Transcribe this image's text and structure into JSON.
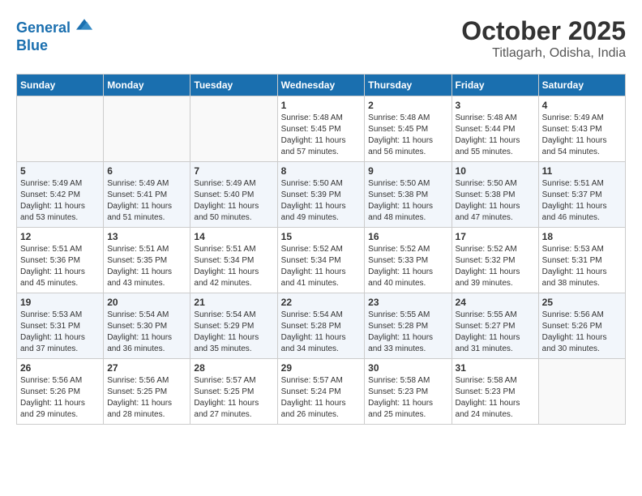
{
  "header": {
    "logo_line1": "General",
    "logo_line2": "Blue",
    "month": "October 2025",
    "location": "Titlagarh, Odisha, India"
  },
  "weekdays": [
    "Sunday",
    "Monday",
    "Tuesday",
    "Wednesday",
    "Thursday",
    "Friday",
    "Saturday"
  ],
  "weeks": [
    [
      {
        "num": "",
        "info": ""
      },
      {
        "num": "",
        "info": ""
      },
      {
        "num": "",
        "info": ""
      },
      {
        "num": "1",
        "info": "Sunrise: 5:48 AM\nSunset: 5:45 PM\nDaylight: 11 hours\nand 57 minutes."
      },
      {
        "num": "2",
        "info": "Sunrise: 5:48 AM\nSunset: 5:45 PM\nDaylight: 11 hours\nand 56 minutes."
      },
      {
        "num": "3",
        "info": "Sunrise: 5:48 AM\nSunset: 5:44 PM\nDaylight: 11 hours\nand 55 minutes."
      },
      {
        "num": "4",
        "info": "Sunrise: 5:49 AM\nSunset: 5:43 PM\nDaylight: 11 hours\nand 54 minutes."
      }
    ],
    [
      {
        "num": "5",
        "info": "Sunrise: 5:49 AM\nSunset: 5:42 PM\nDaylight: 11 hours\nand 53 minutes."
      },
      {
        "num": "6",
        "info": "Sunrise: 5:49 AM\nSunset: 5:41 PM\nDaylight: 11 hours\nand 51 minutes."
      },
      {
        "num": "7",
        "info": "Sunrise: 5:49 AM\nSunset: 5:40 PM\nDaylight: 11 hours\nand 50 minutes."
      },
      {
        "num": "8",
        "info": "Sunrise: 5:50 AM\nSunset: 5:39 PM\nDaylight: 11 hours\nand 49 minutes."
      },
      {
        "num": "9",
        "info": "Sunrise: 5:50 AM\nSunset: 5:38 PM\nDaylight: 11 hours\nand 48 minutes."
      },
      {
        "num": "10",
        "info": "Sunrise: 5:50 AM\nSunset: 5:38 PM\nDaylight: 11 hours\nand 47 minutes."
      },
      {
        "num": "11",
        "info": "Sunrise: 5:51 AM\nSunset: 5:37 PM\nDaylight: 11 hours\nand 46 minutes."
      }
    ],
    [
      {
        "num": "12",
        "info": "Sunrise: 5:51 AM\nSunset: 5:36 PM\nDaylight: 11 hours\nand 45 minutes."
      },
      {
        "num": "13",
        "info": "Sunrise: 5:51 AM\nSunset: 5:35 PM\nDaylight: 11 hours\nand 43 minutes."
      },
      {
        "num": "14",
        "info": "Sunrise: 5:51 AM\nSunset: 5:34 PM\nDaylight: 11 hours\nand 42 minutes."
      },
      {
        "num": "15",
        "info": "Sunrise: 5:52 AM\nSunset: 5:34 PM\nDaylight: 11 hours\nand 41 minutes."
      },
      {
        "num": "16",
        "info": "Sunrise: 5:52 AM\nSunset: 5:33 PM\nDaylight: 11 hours\nand 40 minutes."
      },
      {
        "num": "17",
        "info": "Sunrise: 5:52 AM\nSunset: 5:32 PM\nDaylight: 11 hours\nand 39 minutes."
      },
      {
        "num": "18",
        "info": "Sunrise: 5:53 AM\nSunset: 5:31 PM\nDaylight: 11 hours\nand 38 minutes."
      }
    ],
    [
      {
        "num": "19",
        "info": "Sunrise: 5:53 AM\nSunset: 5:31 PM\nDaylight: 11 hours\nand 37 minutes."
      },
      {
        "num": "20",
        "info": "Sunrise: 5:54 AM\nSunset: 5:30 PM\nDaylight: 11 hours\nand 36 minutes."
      },
      {
        "num": "21",
        "info": "Sunrise: 5:54 AM\nSunset: 5:29 PM\nDaylight: 11 hours\nand 35 minutes."
      },
      {
        "num": "22",
        "info": "Sunrise: 5:54 AM\nSunset: 5:28 PM\nDaylight: 11 hours\nand 34 minutes."
      },
      {
        "num": "23",
        "info": "Sunrise: 5:55 AM\nSunset: 5:28 PM\nDaylight: 11 hours\nand 33 minutes."
      },
      {
        "num": "24",
        "info": "Sunrise: 5:55 AM\nSunset: 5:27 PM\nDaylight: 11 hours\nand 31 minutes."
      },
      {
        "num": "25",
        "info": "Sunrise: 5:56 AM\nSunset: 5:26 PM\nDaylight: 11 hours\nand 30 minutes."
      }
    ],
    [
      {
        "num": "26",
        "info": "Sunrise: 5:56 AM\nSunset: 5:26 PM\nDaylight: 11 hours\nand 29 minutes."
      },
      {
        "num": "27",
        "info": "Sunrise: 5:56 AM\nSunset: 5:25 PM\nDaylight: 11 hours\nand 28 minutes."
      },
      {
        "num": "28",
        "info": "Sunrise: 5:57 AM\nSunset: 5:25 PM\nDaylight: 11 hours\nand 27 minutes."
      },
      {
        "num": "29",
        "info": "Sunrise: 5:57 AM\nSunset: 5:24 PM\nDaylight: 11 hours\nand 26 minutes."
      },
      {
        "num": "30",
        "info": "Sunrise: 5:58 AM\nSunset: 5:23 PM\nDaylight: 11 hours\nand 25 minutes."
      },
      {
        "num": "31",
        "info": "Sunrise: 5:58 AM\nSunset: 5:23 PM\nDaylight: 11 hours\nand 24 minutes."
      },
      {
        "num": "",
        "info": ""
      }
    ]
  ]
}
